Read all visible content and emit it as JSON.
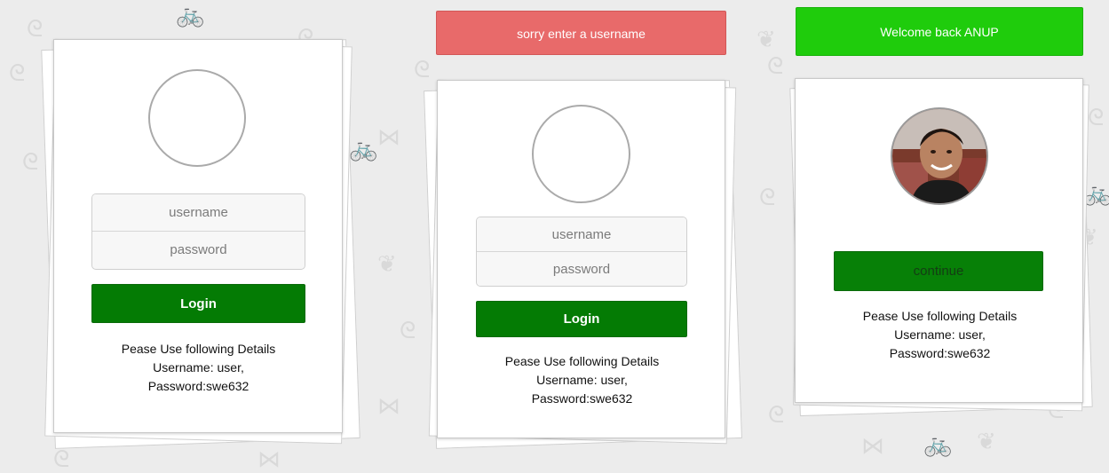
{
  "panels": [
    {
      "username_placeholder": "username",
      "password_placeholder": "password",
      "login_label": "Login",
      "details": {
        "line1": "Pease Use following Details",
        "line2": "Username: user,",
        "line3": "Password:swe632"
      }
    },
    {
      "alert": "sorry enter a username",
      "username_placeholder": "username",
      "password_placeholder": "password",
      "login_label": "Login",
      "details": {
        "line1": "Pease Use following Details",
        "line2": "Username: user,",
        "line3": "Password:swe632"
      }
    },
    {
      "alert": "Welcome back ANUP",
      "continue_label": "continue",
      "details": {
        "line1": "Pease Use following Details",
        "line2": "Username: user,",
        "line3": "Password:swe632"
      }
    }
  ],
  "colors": {
    "login_green": "#047b04",
    "error_red": "#e86a6a",
    "success_green": "#1fcc0c",
    "background": "#ececec"
  },
  "icons": [
    "user-avatar-placeholder-icon",
    "user-photo"
  ]
}
